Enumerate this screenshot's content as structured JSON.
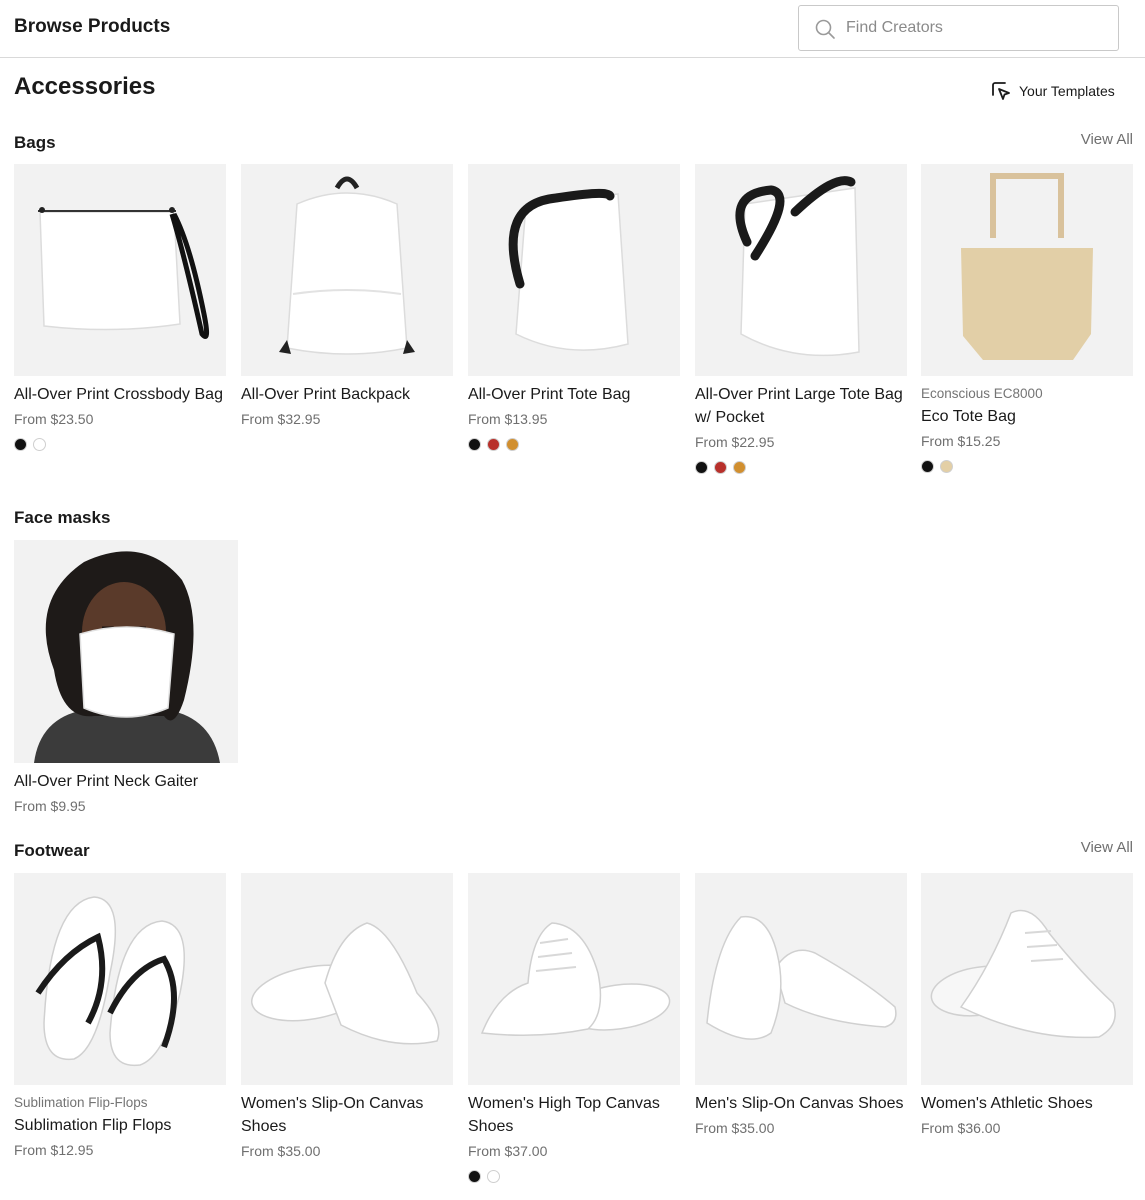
{
  "header": {
    "title": "Browse Products",
    "search_placeholder": "Find Creators",
    "search_icon": "search-icon"
  },
  "page": {
    "title": "Accessories",
    "templates_label": "Your Templates",
    "templates_icon": "cursor-pointer-icon"
  },
  "sections": {
    "bags": {
      "title": "Bags",
      "view_all": "View All",
      "items": [
        {
          "name": "All-Over Print Crossbody Bag",
          "price": "From $23.50",
          "swatches": [
            "#111111",
            "#ffffff"
          ]
        },
        {
          "name": "All-Over Print Backpack",
          "price": "From $32.95",
          "swatches": []
        },
        {
          "name": "All-Over Print Tote Bag",
          "price": "From $13.95",
          "swatches": [
            "#111111",
            "#b8302b",
            "#d18f2f"
          ]
        },
        {
          "name": "All-Over Print Large Tote Bag w/ Pocket",
          "price": "From $22.95",
          "swatches": [
            "#111111",
            "#b8302b",
            "#d18f2f"
          ]
        },
        {
          "brand": "Econscious EC8000",
          "name": "Eco Tote Bag",
          "price": "From $15.25",
          "swatches": [
            "#111111",
            "#e3cfa6"
          ]
        }
      ]
    },
    "face_masks": {
      "title": "Face masks",
      "items": [
        {
          "name": "All-Over Print Neck Gaiter",
          "price": "From $9.95",
          "swatches": []
        }
      ]
    },
    "footwear": {
      "title": "Footwear",
      "view_all": "View All",
      "items": [
        {
          "brand": "Sublimation Flip-Flops",
          "name": "Sublimation Flip Flops",
          "price": "From $12.95",
          "swatches": []
        },
        {
          "name": "Women's Slip-On Canvas Shoes",
          "price": "From $35.00",
          "swatches": []
        },
        {
          "name": "Women's High Top Canvas Shoes",
          "price": "From $37.00",
          "swatches": [
            "#111111",
            "#ffffff"
          ]
        },
        {
          "name": "Men's Slip-On Canvas Shoes",
          "price": "From $35.00",
          "swatches": []
        },
        {
          "name": "Women's Athletic Shoes",
          "price": "From $36.00",
          "swatches": []
        }
      ]
    }
  },
  "colors": {
    "image_bg": "#f2f2f2",
    "muted_text": "#6f6f6f",
    "border": "#d9d9d9"
  }
}
